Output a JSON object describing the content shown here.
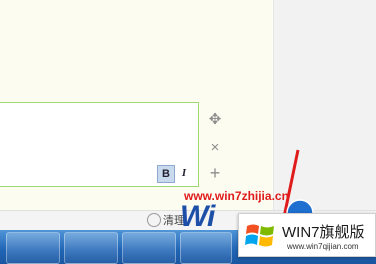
{
  "toolbar": {
    "bold_label": "B",
    "italic_label": "I"
  },
  "side_icons": {
    "move": "✥",
    "close": "×",
    "add": "+"
  },
  "bottom": {
    "clear_label": "清理"
  },
  "watermark": {
    "url": "www.win7zhijia.cn",
    "brand": "Wi"
  },
  "logo": {
    "title": "WIN7旗舰版",
    "site": "www.win7qijian.com"
  },
  "colors": {
    "editor_border": "#9fd870",
    "watermark_red": "#e01b1b",
    "taskbar_blue": "#2064b5"
  }
}
